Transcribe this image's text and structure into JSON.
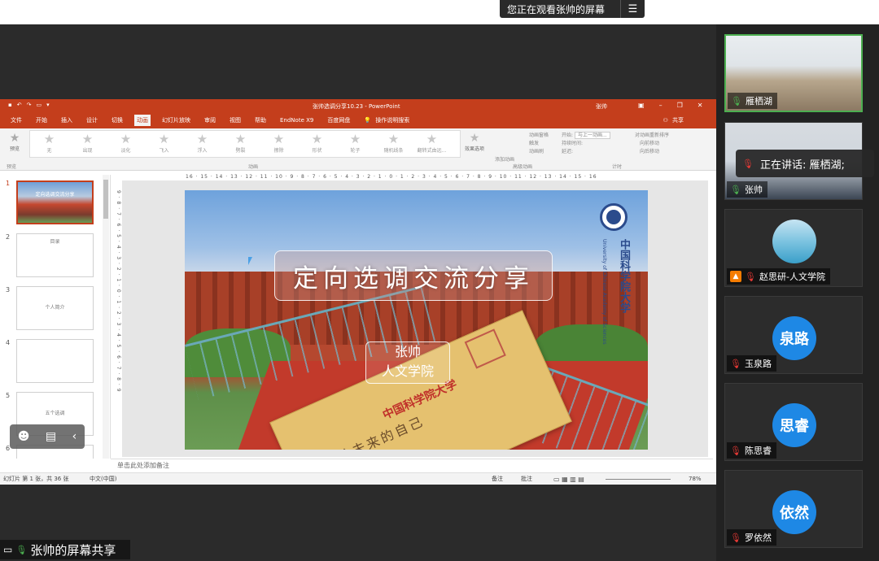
{
  "banner": {
    "text": "您正在观看张帅的屏幕",
    "menu_icon": "hamburger-icon"
  },
  "ppt": {
    "doc_title": "张帅选调分享10.23 - PowerPoint",
    "user": "张帅",
    "tabs": [
      "文件",
      "开始",
      "插入",
      "设计",
      "切换",
      "动画",
      "幻灯片放映",
      "审阅",
      "视图",
      "帮助",
      "EndNote X9",
      "百度网盘",
      "操作说明搜索"
    ],
    "active_tab": "动画",
    "share": "共享",
    "preview_label": "预览",
    "preview_group": "预览",
    "effects": [
      "无",
      "出现",
      "淡化",
      "飞入",
      "浮入",
      "劈裂",
      "擦除",
      "形状",
      "轮子",
      "随机线条",
      "翻转式由远...",
      "效果选项"
    ],
    "anim_group": "动画",
    "adv_items": [
      "动画窗格",
      "触发",
      "动画刷",
      "添加动画"
    ],
    "adv_group": "高级动画",
    "timing_items": [
      "开始:",
      "与上一动画...",
      "持续时间:",
      "延迟:"
    ],
    "timing_group": "计时",
    "reorder_items": [
      "对动画重新排序",
      "向前移动",
      "向后移动"
    ],
    "ruler_h": "16 · 15 · 14 · 13 · 12 · 11 · 10 · 9 · 8 · 7 · 6 · 5 · 4 · 3 · 2 · 1 · 0 · 1 · 2 · 3 · 4 · 5 · 6 · 7 · 8 · 9 · 10 · 11 · 12 · 13 · 14 · 15 · 16",
    "ruler_v": "9 · 8 · 7 · 6 · 5 · 4 · 3 · 2 · 1 · 0 · 1 · 2 · 3 · 4 · 5 · 6 · 7 · 8 · 9",
    "thumbnails": [
      {
        "num": "1",
        "title": "定向选调交流分享"
      },
      {
        "num": "2",
        "title": "目录"
      },
      {
        "num": "3",
        "title": "个人简介"
      },
      {
        "num": "4",
        "title": ""
      },
      {
        "num": "5",
        "title": "五个选调"
      },
      {
        "num": "6",
        "title": ""
      }
    ],
    "slide": {
      "title": "定向选调交流分享",
      "name": "张帅",
      "dept": "人文学院",
      "uni_cn": "中国科学院大学",
      "uni_en": "University of Chinese Academy of Sciences",
      "envelope_text": "写给未来的自己",
      "envelope_red": "中国科学院大学"
    },
    "notes_placeholder": "单击此处添加备注",
    "status_left": "幻灯片 第 1 张，共 36 张",
    "status_lang": "中文(中国)",
    "status_notes": "备注",
    "status_comments": "批注",
    "zoom": "78%",
    "accent": "#c43e1c"
  },
  "screen_share_label": "张帅的屏幕共享",
  "participants": [
    {
      "name": "雁栖湖",
      "type": "video",
      "mic": "on"
    },
    {
      "name": "张帅",
      "type": "video",
      "mic": "on"
    },
    {
      "name": "赵思研-人文学院",
      "type": "photo",
      "mic": "off"
    },
    {
      "name": "玉泉路",
      "avatar": "泉路",
      "type": "avatar",
      "mic": "off"
    },
    {
      "name": "陈思睿",
      "avatar": "思睿",
      "type": "avatar",
      "mic": "off"
    },
    {
      "name": "罗依然",
      "avatar": "依然",
      "type": "avatar",
      "mic": "off"
    }
  ],
  "speaking": "正在讲话: 雁栖湖;"
}
